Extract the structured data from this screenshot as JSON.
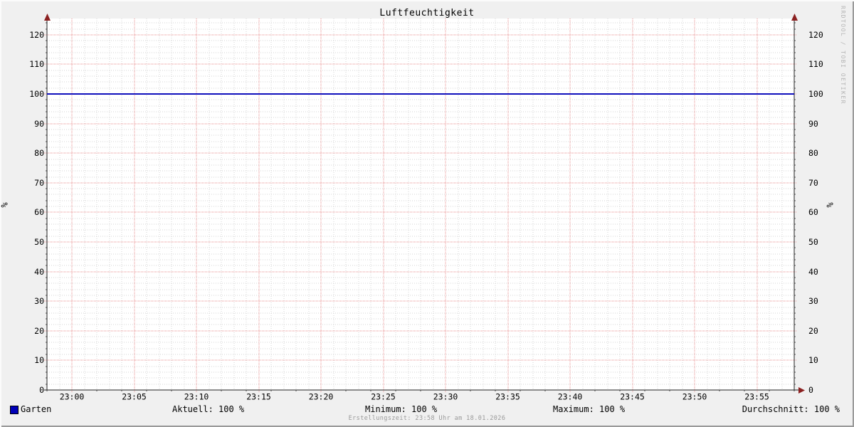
{
  "title": "Luftfeuchtigkeit",
  "watermark": "RRDTOOL / TOBI OETIKER",
  "footer": "Erstellungszeit: 23:58 Uhr am 18.01.2026",
  "y_axis_label_left": "%",
  "y_axis_label_right": "%",
  "chart_data": {
    "type": "line",
    "title": "Luftfeuchtigkeit",
    "ylabel": "%",
    "xlabel": "",
    "ylim": [
      0,
      125.5
    ],
    "y_major_ticks": [
      0,
      10,
      20,
      30,
      40,
      50,
      60,
      70,
      80,
      90,
      100,
      110,
      120
    ],
    "y_minor_step": 2,
    "x_start": "22:58",
    "x_end": "23:58",
    "x_major_ticks": [
      "23:00",
      "23:05",
      "23:10",
      "23:15",
      "23:20",
      "23:25",
      "23:30",
      "23:35",
      "23:40",
      "23:45",
      "23:50",
      "23:55"
    ],
    "x_minor_step_minutes": 2,
    "grid_on": true,
    "dual_y_axis": true,
    "legend_position": "bottom",
    "series": [
      {
        "name": "Garten",
        "color": "#0000b8",
        "x": [
          "22:58",
          "23:58"
        ],
        "values": [
          100,
          100
        ]
      }
    ],
    "stats": {
      "aktuell": "100 %",
      "minimum": "100 %",
      "maximum": "100 %",
      "durchschnitt": "100 %"
    }
  },
  "legend": {
    "series_label": "Garten",
    "swatch_color": "#0000b8",
    "stats": [
      {
        "text": "Aktuell: 100 %"
      },
      {
        "text": "Minimum: 100 %"
      },
      {
        "text": "Maximum: 100 %"
      },
      {
        "text": "Durchschnitt: 100 %"
      }
    ]
  },
  "colors": {
    "background": "#f0f0f0",
    "canvas": "#ffffff",
    "grid_major": "#e98f8f",
    "grid_minor": "#d5d5d5",
    "axis": "#222222",
    "tick": "#555555",
    "arrow": "#8b2020",
    "text": "#000000",
    "footer_text": "#9a9a9a",
    "watermark_text": "#b5b5b5"
  }
}
